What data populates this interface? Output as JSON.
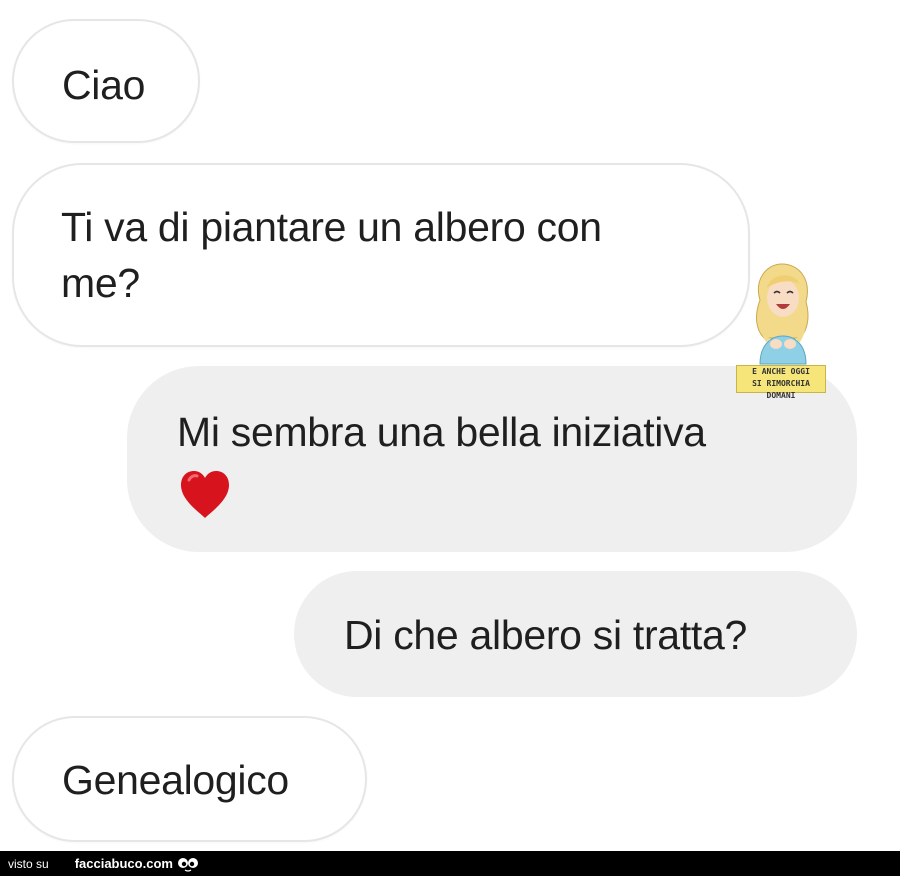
{
  "messages": [
    {
      "id": "b1",
      "direction": "incoming",
      "text": "Ciao"
    },
    {
      "id": "b2",
      "direction": "incoming",
      "line1": "Ti va di piantare un albero con",
      "line2": "me?"
    },
    {
      "id": "b3",
      "direction": "outgoing",
      "text": "Mi sembra una bella iniziativa",
      "emoji": "heart-icon"
    },
    {
      "id": "b4",
      "direction": "outgoing",
      "text": "Di che albero si tratta?"
    },
    {
      "id": "b5",
      "direction": "incoming",
      "text": "Genealogico"
    }
  ],
  "sticker": {
    "caption_line1": "E ANCHE OGGI",
    "caption_line2": "SI RIMORCHIA DOMANI"
  },
  "footer": {
    "visto_label": "visto su",
    "brand": "facciabuco.com",
    "logo_icon": "eyes-logo-icon"
  },
  "colors": {
    "incoming_bubble": "#ffffff",
    "outgoing_bubble": "#efefef",
    "heart": "#d7141e",
    "footer_bg": "#000000"
  }
}
